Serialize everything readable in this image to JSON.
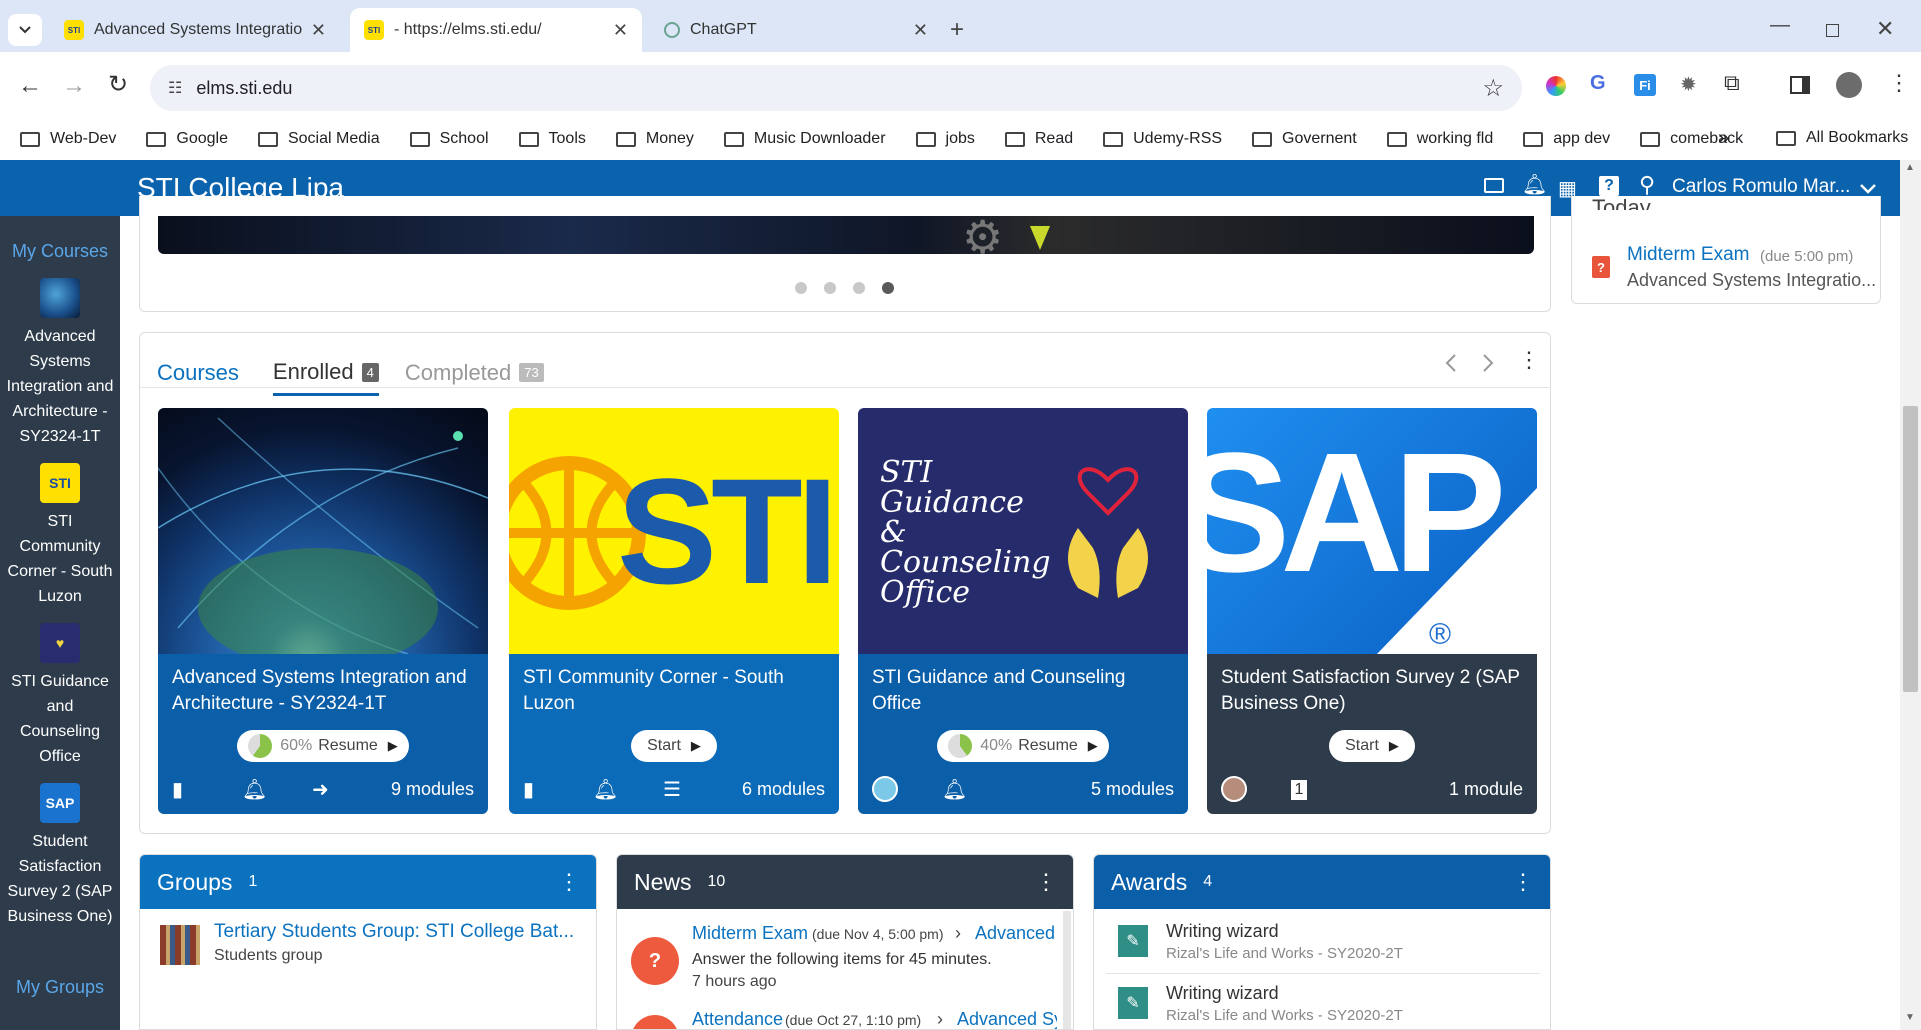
{
  "browser": {
    "tabs": [
      {
        "title": "Advanced Systems Integration",
        "favicon": "sti-logo"
      },
      {
        "title": "- https://elms.sti.edu/",
        "favicon": "sti-logo"
      },
      {
        "title": "ChatGPT",
        "favicon": "chatgpt-icon"
      }
    ],
    "url": "elms.sti.edu",
    "bookmarks": [
      "Web-Dev",
      "Google",
      "Social Media",
      "School",
      "Tools",
      "Money",
      "Music Downloader",
      "jobs",
      "Read",
      "Udemy-RSS",
      "Governent",
      "working fld",
      "app dev",
      "comeback"
    ],
    "all_bookmarks": "All Bookmarks",
    "more": "»"
  },
  "navbar": {
    "brand": "STI College Lipa",
    "user": "Carlos Romulo Mar..."
  },
  "sidebar": {
    "heading": "My Courses",
    "items": [
      {
        "label": "Advanced Systems Integration and Architecture - SY2324-1T"
      },
      {
        "label": "STI Community Corner - South Luzon"
      },
      {
        "label": "STI Guidance and Counseling Office"
      },
      {
        "label": "Student Satisfaction Survey 2 (SAP Business One)"
      }
    ],
    "footer": "My Groups"
  },
  "courses_section": {
    "tabs": [
      {
        "label": "Courses"
      },
      {
        "label": "Enrolled",
        "count": "4"
      },
      {
        "label": "Completed",
        "count": "73"
      }
    ],
    "cards": [
      {
        "title": "Advanced Systems Integration and Architecture - SY2324-1T",
        "action": "Resume",
        "progress": "60%",
        "modules": "9 modules",
        "color": "#0b5ea8"
      },
      {
        "title": "STI Community Corner - South Luzon",
        "action": "Start",
        "progress": "",
        "modules": "6 modules",
        "color": "#0b6bb8"
      },
      {
        "title": "STI Guidance and Counseling Office",
        "action": "Resume",
        "progress": "40%",
        "modules": "5 modules",
        "color": "#0b5ea8"
      },
      {
        "title": "Student Satisfaction Survey 2 (SAP Business One)",
        "action": "Start",
        "progress": "",
        "modules": "1 module",
        "color": "#2d3b4a"
      }
    ],
    "sti_logo": "STI",
    "guidance_logo": "STI Guidance & Counseling Office",
    "sap_logo": "SAP",
    "sap_mark": "®"
  },
  "todo": {
    "heading": "Today",
    "item_title": "Midterm Exam",
    "item_due": "(due 5:00 pm)",
    "item_course": "Advanced Systems Integratio..."
  },
  "groups": {
    "title": "Groups",
    "count": "1",
    "item_title": "Tertiary Students Group: STI College Bat...",
    "item_sub": "Students group"
  },
  "news": {
    "title": "News",
    "count": "10",
    "items": [
      {
        "title": "Midterm Exam",
        "due": "(due Nov 4, 5:00 pm)",
        "course": "Advanced S",
        "desc": "Answer the following items for 45 minutes.",
        "time": "7 hours ago"
      },
      {
        "title": "Attendance",
        "due": "(due Oct 27, 1:10 pm)",
        "course": "Advanced Sys"
      }
    ]
  },
  "awards": {
    "title": "Awards",
    "count": "4",
    "items": [
      {
        "title": "Writing wizard",
        "sub": "Rizal's Life and Works - SY2020-2T"
      },
      {
        "title": "Writing wizard",
        "sub": "Rizal's Life and Works - SY2020-2T"
      }
    ]
  },
  "colors": {
    "navbar": "#0b63ad",
    "sidebar": "#2d3b4a",
    "accent": "#0b72c0",
    "news_head": "#2d3b4a",
    "awards_head": "#0b5ea8"
  }
}
